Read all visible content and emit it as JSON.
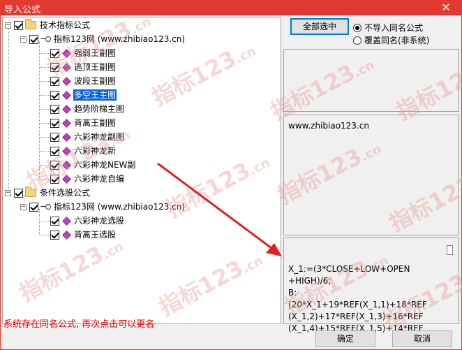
{
  "window": {
    "title": "导入公式",
    "close_glyph": "✕"
  },
  "tree": {
    "group1": {
      "label": "技术指标公式",
      "source": "指标123网 (www.zhibiao123.cn)",
      "items": [
        "强弱王副图",
        "逃顶王副图",
        "波段王副图",
        "多空王主图",
        "趋势阶梯主图",
        "背离王副图",
        "六彩神龙副图",
        "六彩神龙新",
        "六彩神龙NEW副",
        "六彩神龙自编"
      ],
      "selected_index": 3
    },
    "group2": {
      "label": "条件选股公式",
      "source": "指标123网 (www.zhibiao123.cn)",
      "items": [
        "六彩神龙选股",
        "背离王选股"
      ]
    },
    "expander_glyph": "−"
  },
  "right": {
    "select_all_label": "全部选中",
    "radio_options": [
      "不导入同名公式",
      "覆盖同名(非系统)"
    ],
    "radio_selected": 0,
    "info_text": "www.zhibiao123.cn",
    "formula_lines": [
      "X_1:=(3*CLOSE+LOW+OPEN",
      "+HIGH)/6;",
      " B:(20*X_1+19*REF(X_1,1)+18*REF",
      "(X_1,2)+17*REF(X_1,3)+16*REF",
      "(X_1,4)+15*REF(X_1,5)+14*REF"
    ]
  },
  "footer": {
    "status_text": "系统存在同名公式, 再次点击可以更名",
    "ok_label": "确定",
    "cancel_label": "取消"
  },
  "colors": {
    "titlebar": "#e13a32",
    "selection": "#0a64d8",
    "status": "#e00000",
    "arrow": "#e02020"
  },
  "watermark": {
    "text": "指标123",
    "suffix": ".cn"
  }
}
